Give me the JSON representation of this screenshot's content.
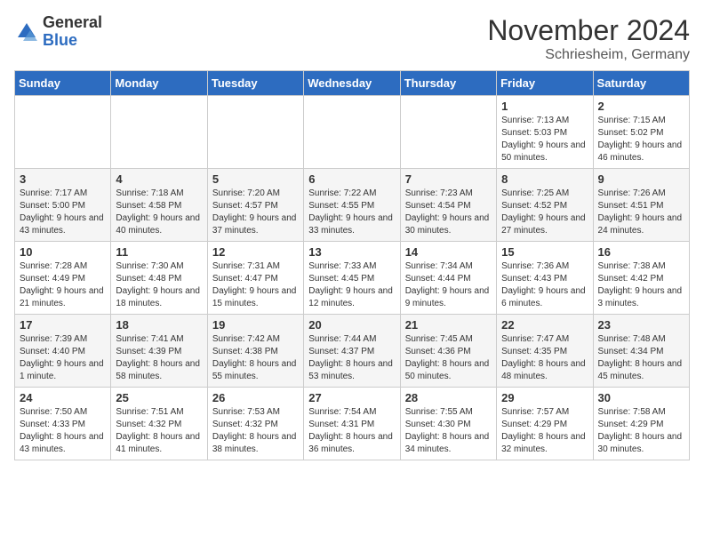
{
  "logo": {
    "general": "General",
    "blue": "Blue"
  },
  "header": {
    "month": "November 2024",
    "location": "Schriesheim, Germany"
  },
  "weekdays": [
    "Sunday",
    "Monday",
    "Tuesday",
    "Wednesday",
    "Thursday",
    "Friday",
    "Saturday"
  ],
  "weeks": [
    [
      {
        "day": "",
        "info": ""
      },
      {
        "day": "",
        "info": ""
      },
      {
        "day": "",
        "info": ""
      },
      {
        "day": "",
        "info": ""
      },
      {
        "day": "",
        "info": ""
      },
      {
        "day": "1",
        "info": "Sunrise: 7:13 AM\nSunset: 5:03 PM\nDaylight: 9 hours and 50 minutes."
      },
      {
        "day": "2",
        "info": "Sunrise: 7:15 AM\nSunset: 5:02 PM\nDaylight: 9 hours and 46 minutes."
      }
    ],
    [
      {
        "day": "3",
        "info": "Sunrise: 7:17 AM\nSunset: 5:00 PM\nDaylight: 9 hours and 43 minutes."
      },
      {
        "day": "4",
        "info": "Sunrise: 7:18 AM\nSunset: 4:58 PM\nDaylight: 9 hours and 40 minutes."
      },
      {
        "day": "5",
        "info": "Sunrise: 7:20 AM\nSunset: 4:57 PM\nDaylight: 9 hours and 37 minutes."
      },
      {
        "day": "6",
        "info": "Sunrise: 7:22 AM\nSunset: 4:55 PM\nDaylight: 9 hours and 33 minutes."
      },
      {
        "day": "7",
        "info": "Sunrise: 7:23 AM\nSunset: 4:54 PM\nDaylight: 9 hours and 30 minutes."
      },
      {
        "day": "8",
        "info": "Sunrise: 7:25 AM\nSunset: 4:52 PM\nDaylight: 9 hours and 27 minutes."
      },
      {
        "day": "9",
        "info": "Sunrise: 7:26 AM\nSunset: 4:51 PM\nDaylight: 9 hours and 24 minutes."
      }
    ],
    [
      {
        "day": "10",
        "info": "Sunrise: 7:28 AM\nSunset: 4:49 PM\nDaylight: 9 hours and 21 minutes."
      },
      {
        "day": "11",
        "info": "Sunrise: 7:30 AM\nSunset: 4:48 PM\nDaylight: 9 hours and 18 minutes."
      },
      {
        "day": "12",
        "info": "Sunrise: 7:31 AM\nSunset: 4:47 PM\nDaylight: 9 hours and 15 minutes."
      },
      {
        "day": "13",
        "info": "Sunrise: 7:33 AM\nSunset: 4:45 PM\nDaylight: 9 hours and 12 minutes."
      },
      {
        "day": "14",
        "info": "Sunrise: 7:34 AM\nSunset: 4:44 PM\nDaylight: 9 hours and 9 minutes."
      },
      {
        "day": "15",
        "info": "Sunrise: 7:36 AM\nSunset: 4:43 PM\nDaylight: 9 hours and 6 minutes."
      },
      {
        "day": "16",
        "info": "Sunrise: 7:38 AM\nSunset: 4:42 PM\nDaylight: 9 hours and 3 minutes."
      }
    ],
    [
      {
        "day": "17",
        "info": "Sunrise: 7:39 AM\nSunset: 4:40 PM\nDaylight: 9 hours and 1 minute."
      },
      {
        "day": "18",
        "info": "Sunrise: 7:41 AM\nSunset: 4:39 PM\nDaylight: 8 hours and 58 minutes."
      },
      {
        "day": "19",
        "info": "Sunrise: 7:42 AM\nSunset: 4:38 PM\nDaylight: 8 hours and 55 minutes."
      },
      {
        "day": "20",
        "info": "Sunrise: 7:44 AM\nSunset: 4:37 PM\nDaylight: 8 hours and 53 minutes."
      },
      {
        "day": "21",
        "info": "Sunrise: 7:45 AM\nSunset: 4:36 PM\nDaylight: 8 hours and 50 minutes."
      },
      {
        "day": "22",
        "info": "Sunrise: 7:47 AM\nSunset: 4:35 PM\nDaylight: 8 hours and 48 minutes."
      },
      {
        "day": "23",
        "info": "Sunrise: 7:48 AM\nSunset: 4:34 PM\nDaylight: 8 hours and 45 minutes."
      }
    ],
    [
      {
        "day": "24",
        "info": "Sunrise: 7:50 AM\nSunset: 4:33 PM\nDaylight: 8 hours and 43 minutes."
      },
      {
        "day": "25",
        "info": "Sunrise: 7:51 AM\nSunset: 4:32 PM\nDaylight: 8 hours and 41 minutes."
      },
      {
        "day": "26",
        "info": "Sunrise: 7:53 AM\nSunset: 4:32 PM\nDaylight: 8 hours and 38 minutes."
      },
      {
        "day": "27",
        "info": "Sunrise: 7:54 AM\nSunset: 4:31 PM\nDaylight: 8 hours and 36 minutes."
      },
      {
        "day": "28",
        "info": "Sunrise: 7:55 AM\nSunset: 4:30 PM\nDaylight: 8 hours and 34 minutes."
      },
      {
        "day": "29",
        "info": "Sunrise: 7:57 AM\nSunset: 4:29 PM\nDaylight: 8 hours and 32 minutes."
      },
      {
        "day": "30",
        "info": "Sunrise: 7:58 AM\nSunset: 4:29 PM\nDaylight: 8 hours and 30 minutes."
      }
    ]
  ]
}
